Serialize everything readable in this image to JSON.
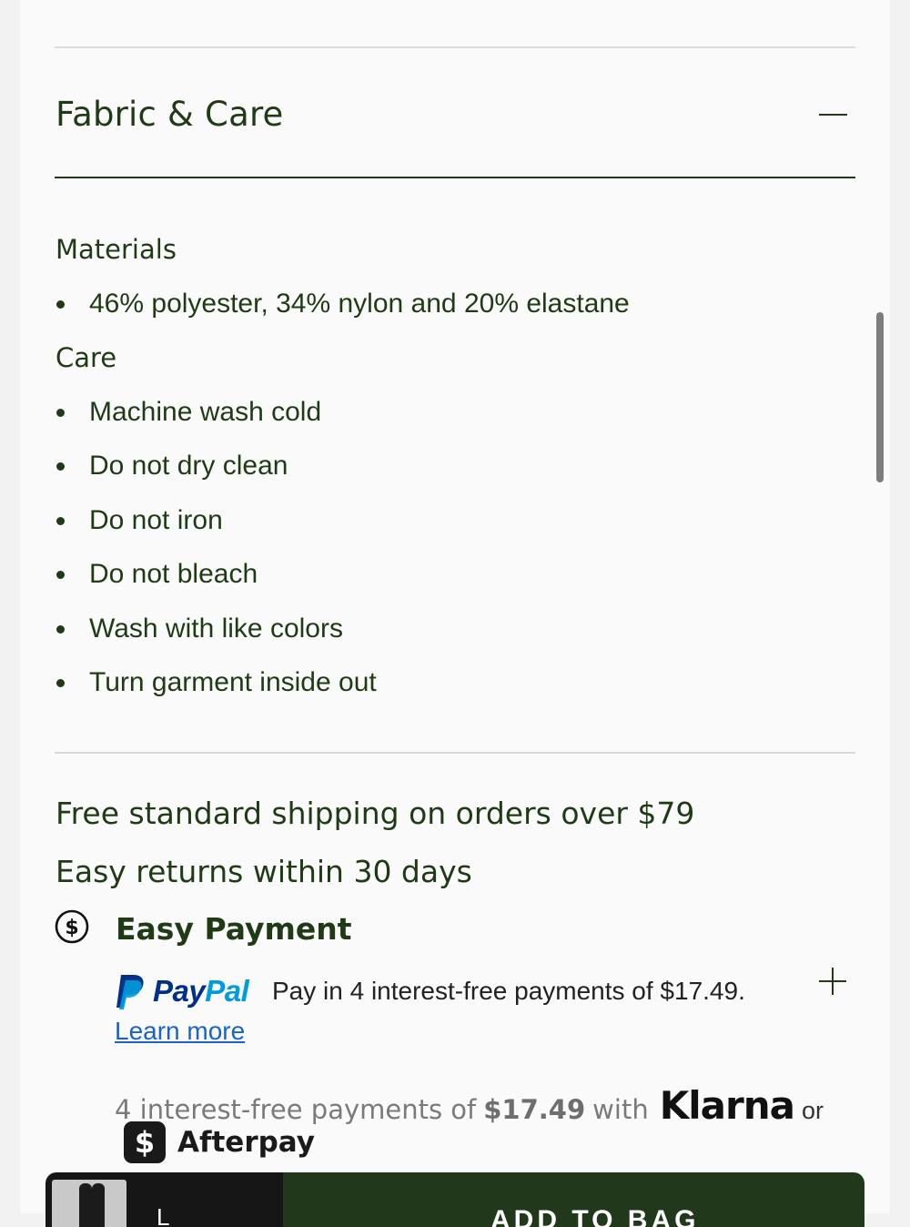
{
  "fabric_care": {
    "title": "Fabric & Care",
    "materials_label": "Materials",
    "materials": [
      "46% polyester, 34% nylon and 20% elastane"
    ],
    "care_label": "Care",
    "care_items": [
      "Machine wash cold",
      "Do not dry clean",
      "Do not iron",
      "Do not bleach",
      "Wash with like colors",
      "Turn garment inside out"
    ]
  },
  "shipping": {
    "free_shipping": "Free standard shipping on orders over $79",
    "returns": "Easy returns within 30 days"
  },
  "payment": {
    "title": "Easy Payment",
    "paypal_brand_pay": "Pay",
    "paypal_brand_pal": "Pal",
    "paypal_text": "Pay in 4 interest-free payments of $17.49.",
    "learn_more": "Learn more",
    "klarna_prefix": "4 interest-free payments of",
    "klarna_amount": "$17.49",
    "klarna_with": "with",
    "klarna_brand": "Klarna",
    "or_text": "or",
    "afterpay_symbol": "$",
    "afterpay_label": "Afterpay"
  },
  "bottom_bar": {
    "size_text": "L",
    "add_to_bag": "ADD TO BAG"
  },
  "colors": {
    "brand_green": "#1f3a15",
    "paypal_blue": "#003087",
    "paypal_light_blue": "#009cde",
    "link_blue": "#1a63c6"
  },
  "icons": {
    "collapse": "minus-icon",
    "expand": "plus-icon",
    "payment": "dollar-circle-icon"
  }
}
